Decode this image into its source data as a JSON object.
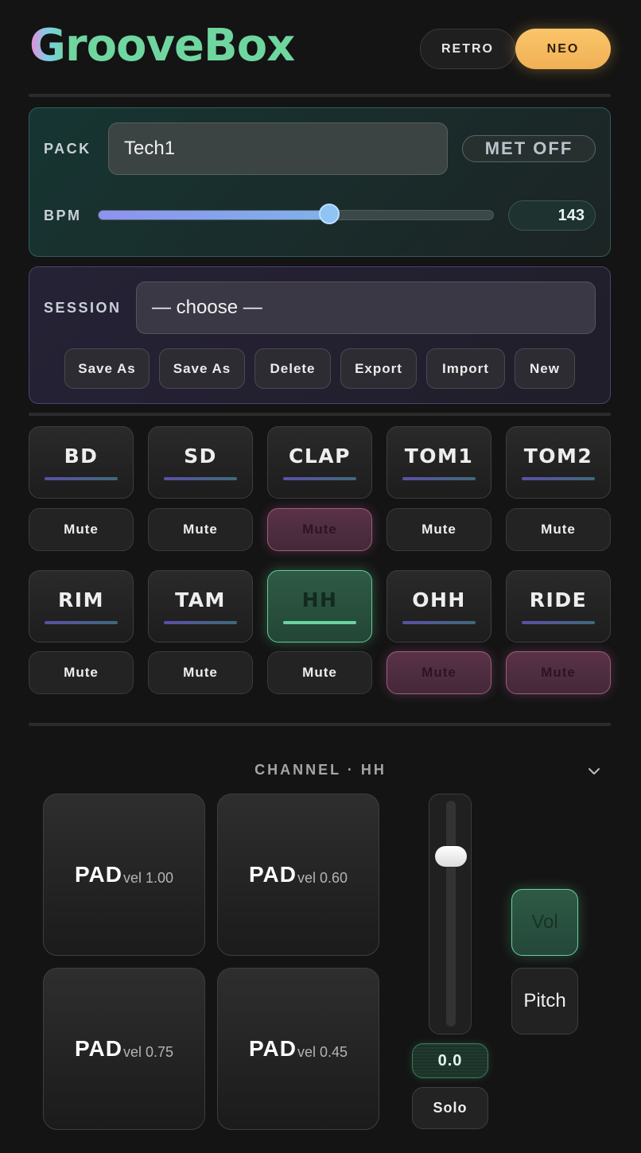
{
  "app": {
    "title": "GrooveBox"
  },
  "theme": {
    "options": [
      "RETRO",
      "NEO"
    ],
    "selected": "NEO"
  },
  "pack": {
    "label": "PACK",
    "value": "Tech1",
    "metronome": "MET OFF",
    "bpm_label": "BPM",
    "bpm": 143,
    "bpm_fraction": 0.585
  },
  "session": {
    "label": "SESSION",
    "selected": "— choose —",
    "buttons": [
      "Save As",
      "Save As",
      "Delete",
      "Export",
      "Import",
      "New"
    ]
  },
  "tracks": [
    {
      "name": "BD",
      "mute": "Mute",
      "muted": false,
      "active": false
    },
    {
      "name": "SD",
      "mute": "Mute",
      "muted": false,
      "active": false
    },
    {
      "name": "CLAP",
      "mute": "Mute",
      "muted": true,
      "active": false
    },
    {
      "name": "TOM1",
      "mute": "Mute",
      "muted": false,
      "active": false
    },
    {
      "name": "TOM2",
      "mute": "Mute",
      "muted": false,
      "active": false
    },
    {
      "name": "RIM",
      "mute": "Mute",
      "muted": false,
      "active": false
    },
    {
      "name": "TAM",
      "mute": "Mute",
      "muted": false,
      "active": false
    },
    {
      "name": "HH",
      "mute": "Mute",
      "muted": false,
      "active": true
    },
    {
      "name": "OHH",
      "mute": "Mute",
      "muted": true,
      "active": false
    },
    {
      "name": "RIDE",
      "mute": "Mute",
      "muted": true,
      "active": false
    }
  ],
  "channel": {
    "title": "CHANNEL · HH",
    "pads": [
      {
        "label": "PAD",
        "vel": "vel 1.00"
      },
      {
        "label": "PAD",
        "vel": "vel 0.60"
      },
      {
        "label": "PAD",
        "vel": "vel 0.75"
      },
      {
        "label": "PAD",
        "vel": "vel 0.45"
      }
    ],
    "fader_value": "0.0",
    "fader_level": 0.78,
    "solo": "Solo",
    "modes": [
      "Vol",
      "Pitch"
    ],
    "selected_mode": "Vol"
  },
  "colors": {
    "accent_green": "#6fd6a0",
    "accent_orange": "#fbc56a",
    "mute_on": "#5a3248"
  },
  "icons": {
    "collapse": "chevron-down-icon"
  }
}
